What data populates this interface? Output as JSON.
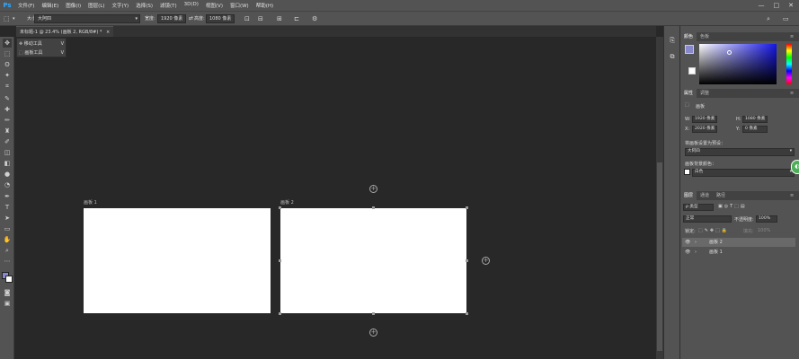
{
  "app": {
    "logo": "Ps"
  },
  "menu": [
    "文件(F)",
    "编辑(E)",
    "图像(I)",
    "图层(L)",
    "文字(Y)",
    "选择(S)",
    "滤镜(T)",
    "3D(D)",
    "视图(V)",
    "窗口(W)",
    "帮助(H)"
  ],
  "window_controls": [
    "—",
    "□",
    "✕"
  ],
  "options": {
    "size_label": "大小:",
    "size_value": "大阿四",
    "width_label": "宽度:",
    "width_value": "1920 像素",
    "height_label": "高度:",
    "height_value": "1080 像素"
  },
  "document_tab": {
    "title": "未标题-1 @ 23.4% (画板 2, RGB/8#) *",
    "close": "×"
  },
  "tool_popup": {
    "items": [
      {
        "label": "移动工具",
        "shortcut": "V"
      },
      {
        "label": "画板工具",
        "shortcut": "V"
      }
    ]
  },
  "artboards": [
    {
      "label": "画板 1"
    },
    {
      "label": "画板 2"
    }
  ],
  "panels": {
    "color_tabs": [
      "颜色",
      "色板"
    ],
    "properties_tabs": [
      "属性",
      "调整"
    ],
    "artboard_title": "画板",
    "w_label": "W:",
    "w_value": "1920 像素",
    "h_label": "H:",
    "h_value": "1080 像素",
    "x_label": "X:",
    "x_value": "2020 像素",
    "y_label": "Y:",
    "y_value": "0 像素",
    "preset_label": "将画板设置为预设：",
    "preset_value": "大阿四",
    "bg_label": "画板背景颜色：",
    "bg_value": "白色",
    "layers_tabs": [
      "图层",
      "通道",
      "路径"
    ],
    "kind_value": "ρ 类型",
    "blend_value": "正常",
    "opacity_label": "不透明度:",
    "opacity_value": "100%",
    "lock_label": "锁定:",
    "fill_label": "填充:",
    "fill_value": "100%",
    "layers": [
      {
        "name": "画板 2",
        "selected": true
      },
      {
        "name": "画板 1",
        "selected": false
      }
    ]
  },
  "colors": {
    "foreground": "#8888cc",
    "background": "#ffffff",
    "accent": "#31a8ff"
  }
}
